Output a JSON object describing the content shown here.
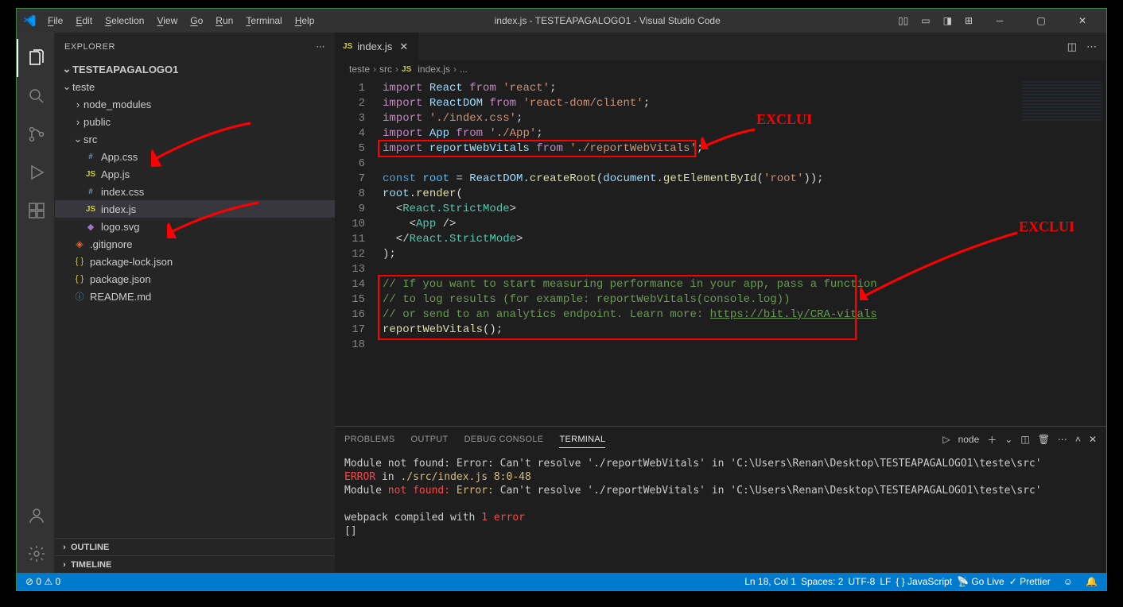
{
  "title": "index.js - TESTEAPAGALOGO1 - Visual Studio Code",
  "menu": [
    "File",
    "Edit",
    "Selection",
    "View",
    "Go",
    "Run",
    "Terminal",
    "Help"
  ],
  "menu_hotkeys": [
    "F",
    "E",
    "S",
    "V",
    "G",
    "R",
    "T",
    "H"
  ],
  "sidebar": {
    "title": "EXPLORER",
    "project": "TESTEAPAGALOGO1",
    "tree": [
      {
        "indent": 0,
        "type": "folder-open",
        "label": "teste"
      },
      {
        "indent": 1,
        "type": "folder",
        "label": "node_modules"
      },
      {
        "indent": 1,
        "type": "folder",
        "label": "public"
      },
      {
        "indent": 1,
        "type": "folder-open",
        "label": "src"
      },
      {
        "indent": 2,
        "type": "css",
        "label": "App.css"
      },
      {
        "indent": 2,
        "type": "js",
        "label": "App.js"
      },
      {
        "indent": 2,
        "type": "css",
        "label": "index.css"
      },
      {
        "indent": 2,
        "type": "js",
        "label": "index.js",
        "selected": true
      },
      {
        "indent": 2,
        "type": "svg",
        "label": "logo.svg"
      },
      {
        "indent": 1,
        "type": "git",
        "label": ".gitignore"
      },
      {
        "indent": 1,
        "type": "json",
        "label": "package-lock.json"
      },
      {
        "indent": 1,
        "type": "json",
        "label": "package.json"
      },
      {
        "indent": 1,
        "type": "md",
        "label": "README.md"
      }
    ],
    "sections": [
      "OUTLINE",
      "TIMELINE"
    ]
  },
  "tab": {
    "icon": "JS",
    "label": "index.js"
  },
  "breadcrumbs": [
    "teste",
    "src",
    "index.js",
    "..."
  ],
  "bc_icons": [
    "",
    "",
    "JS",
    ""
  ],
  "code": {
    "line_count": 18,
    "tokens": [
      [
        [
          "import ",
          "t-key"
        ],
        [
          "React ",
          "t-var"
        ],
        [
          "from ",
          "t-key"
        ],
        [
          "'react'",
          "t-str"
        ],
        [
          ";",
          "t-def"
        ]
      ],
      [
        [
          "import ",
          "t-key"
        ],
        [
          "ReactDOM ",
          "t-var"
        ],
        [
          "from ",
          "t-key"
        ],
        [
          "'react-dom/client'",
          "t-str"
        ],
        [
          ";",
          "t-def"
        ]
      ],
      [
        [
          "import ",
          "t-key"
        ],
        [
          "'./index.css'",
          "t-str"
        ],
        [
          ";",
          "t-def"
        ]
      ],
      [
        [
          "import ",
          "t-key"
        ],
        [
          "App ",
          "t-var"
        ],
        [
          "from ",
          "t-key"
        ],
        [
          "'./App'",
          "t-str"
        ],
        [
          ";",
          "t-def"
        ]
      ],
      [
        [
          "import ",
          "t-key"
        ],
        [
          "reportWebVitals ",
          "t-var"
        ],
        [
          "from ",
          "t-key"
        ],
        [
          "'./reportWebVitals'",
          "t-str"
        ],
        [
          ";",
          "t-def"
        ]
      ],
      [],
      [
        [
          "const ",
          "t-const"
        ],
        [
          "root ",
          "t-num"
        ],
        [
          "= ",
          "t-def"
        ],
        [
          "ReactDOM",
          "t-var"
        ],
        [
          ".",
          "t-def"
        ],
        [
          "createRoot",
          "t-fn"
        ],
        [
          "(",
          "t-def"
        ],
        [
          "document",
          "t-var"
        ],
        [
          ".",
          "t-def"
        ],
        [
          "getElementById",
          "t-fn"
        ],
        [
          "(",
          "t-def"
        ],
        [
          "'root'",
          "t-str"
        ],
        [
          "));",
          "t-def"
        ]
      ],
      [
        [
          "root",
          "t-var"
        ],
        [
          ".",
          "t-def"
        ],
        [
          "render",
          "t-fn"
        ],
        [
          "(",
          "t-def"
        ]
      ],
      [
        [
          "  <",
          "t-def"
        ],
        [
          "React.StrictMode",
          "t-cls"
        ],
        [
          ">",
          "t-def"
        ]
      ],
      [
        [
          "    <",
          "t-def"
        ],
        [
          "App ",
          "t-cls"
        ],
        [
          "/>",
          "t-def"
        ]
      ],
      [
        [
          "  </",
          "t-def"
        ],
        [
          "React.StrictMode",
          "t-cls"
        ],
        [
          ">",
          "t-def"
        ]
      ],
      [
        [
          ");",
          "t-def"
        ]
      ],
      [],
      [
        [
          "// If you want to start measuring performance in your app, pass a function",
          "t-com"
        ]
      ],
      [
        [
          "// to log results (for example: reportWebVitals(console.log))",
          "t-com"
        ]
      ],
      [
        [
          "// or send to an analytics endpoint. Learn more: ",
          "t-com"
        ],
        [
          "https://bit.ly/CRA-vitals",
          "t-lnk"
        ]
      ],
      [
        [
          "reportWebVitals",
          "t-fn"
        ],
        [
          "();",
          "t-def"
        ]
      ],
      []
    ]
  },
  "annotations": {
    "label1": "EXCLUI",
    "label2": "EXCLUI"
  },
  "panel": {
    "tabs": [
      "PROBLEMS",
      "OUTPUT",
      "DEBUG CONSOLE",
      "TERMINAL"
    ],
    "active": 3,
    "shell": "node",
    "lines": [
      {
        "cls": "",
        "text": "Module not found: Error: Can't resolve './reportWebVitals' in 'C:\\Users\\Renan\\Desktop\\TESTEAPAGALOGO1\\teste\\src'"
      },
      {
        "cls": "inline",
        "parts": [
          [
            "ERROR",
            "term-err"
          ],
          [
            " in ",
            ""
          ],
          [
            "./src/index.js 8:0-48",
            "term-warn"
          ]
        ]
      },
      {
        "cls": "inline",
        "parts": [
          [
            "Module ",
            ""
          ],
          [
            "not found:",
            "term-err"
          ],
          [
            " ",
            ""
          ],
          [
            "Error:",
            "term-warn"
          ],
          [
            " Can't resolve './reportWebVitals' in 'C:\\Users\\Renan\\Desktop\\TESTEAPAGALOGO1\\teste\\src'",
            ""
          ]
        ]
      },
      {
        "cls": "",
        "text": ""
      },
      {
        "cls": "inline",
        "parts": [
          [
            "webpack compiled with ",
            ""
          ],
          [
            "1 error",
            "term-err"
          ]
        ]
      },
      {
        "cls": "",
        "text": "[]"
      }
    ]
  },
  "status": {
    "left": "⊘ 0 ⚠ 0",
    "right": [
      "Ln 18, Col 1",
      "Spaces: 2",
      "UTF-8",
      "LF",
      "{ } JavaScript",
      "📡 Go Live",
      "✓ Prettier"
    ]
  }
}
